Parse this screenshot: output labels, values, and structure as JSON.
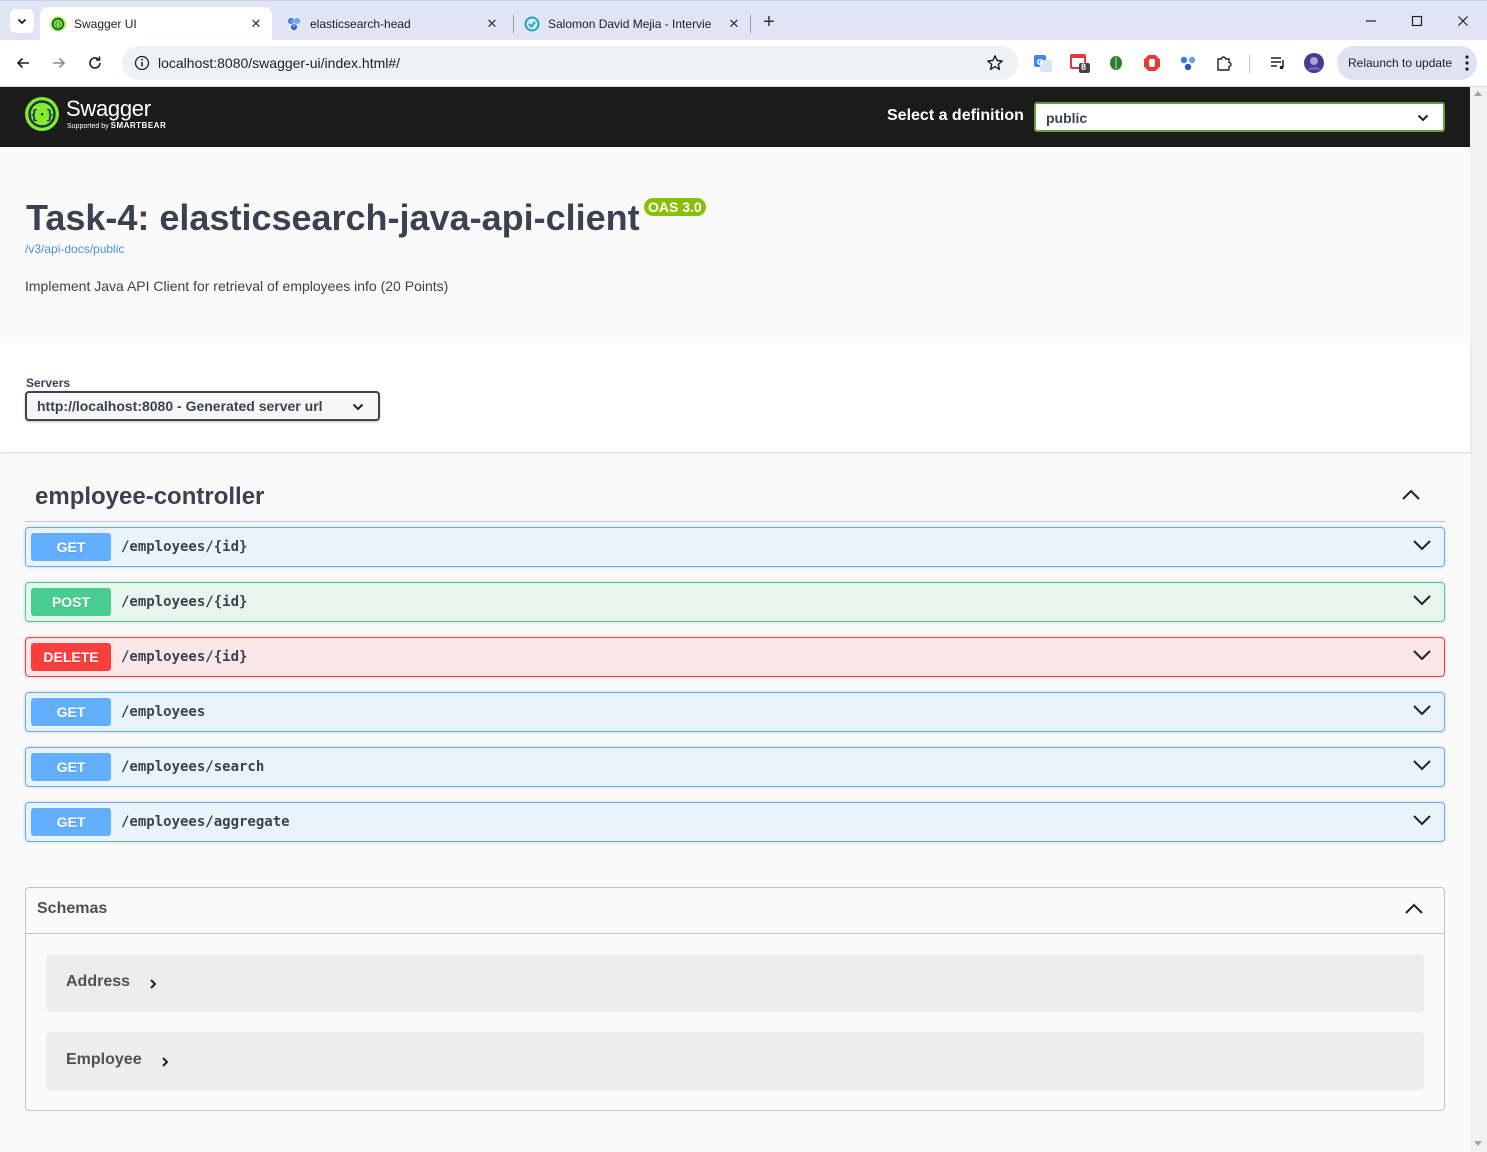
{
  "browser": {
    "tabs": [
      {
        "title": "Swagger UI",
        "favicon": "swagger-favicon-icon",
        "active": true
      },
      {
        "title": "elasticsearch-head",
        "favicon": "elasticsearch-head-favicon-icon",
        "active": false
      },
      {
        "title": "Salomon David Mejia - Intervie",
        "favicon": "interview-favicon-icon",
        "active": false
      }
    ],
    "address": "localhost:8080/swagger-ui/index.html#/",
    "extension_badge": "8",
    "relaunch_label": "Relaunch to update"
  },
  "topbar": {
    "logo_name": "Swagger",
    "logo_supported_by": "Supported by",
    "logo_company": "SMARTBEAR",
    "definition_label": "Select a definition",
    "definition_value": "public"
  },
  "info": {
    "title": "Task-4: elasticsearch-java-api-client",
    "version_badge": "OAS 3.0",
    "spec_url": "/v3/api-docs/public",
    "description": "Implement Java API Client for retrieval of employees info (20 Points)"
  },
  "servers": {
    "label": "Servers",
    "selected": "http://localhost:8080 - Generated server url"
  },
  "tag": {
    "name": "employee-controller",
    "expanded": true
  },
  "operations": [
    {
      "method": "GET",
      "path": "/employees/{id}"
    },
    {
      "method": "POST",
      "path": "/employees/{id}"
    },
    {
      "method": "DELETE",
      "path": "/employees/{id}"
    },
    {
      "method": "GET",
      "path": "/employees"
    },
    {
      "method": "GET",
      "path": "/employees/search"
    },
    {
      "method": "GET",
      "path": "/employees/aggregate"
    }
  ],
  "schemas": {
    "title": "Schemas",
    "expanded": true,
    "items": [
      "Address",
      "Employee"
    ]
  },
  "colors": {
    "get": "#61affe",
    "post": "#49cc90",
    "delete": "#f93e3e",
    "swagger_green": "#85ea2d",
    "oas_badge": "#89bf04",
    "topbar_bg": "#1b1b1b"
  }
}
